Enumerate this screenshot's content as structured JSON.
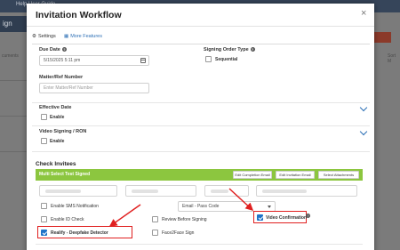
{
  "background": {
    "topbar_text": "Help User Guide",
    "app_title": "ign",
    "left_label": "cuments",
    "right_label": "Sort M"
  },
  "modal": {
    "title": "Invitation Workflow",
    "close": "×"
  },
  "tabs": [
    {
      "label": "Settings",
      "icon": "gear-icon"
    },
    {
      "label": "More Features",
      "icon": "grid-icon"
    }
  ],
  "due_date": {
    "label": "Due Date",
    "value": "5/15/2025 5:11 pm"
  },
  "signing_order": {
    "label": "Signing Order Type",
    "option": "Sequential",
    "checked": false
  },
  "matter": {
    "label": "Matter/Ref Number",
    "placeholder": "Enter Matter/Ref Number"
  },
  "effective_date": {
    "label": "Effective Date",
    "option": "Enable",
    "checked": false
  },
  "video_signing": {
    "label": "Video Signing / RON",
    "option": "Enable",
    "checked": false
  },
  "check_invitees": {
    "title": "Check Invitees",
    "bar_title": "Multi Select Test Signed",
    "buttons": [
      "Edit Completion Email",
      "Edit Invitation Email",
      "Select Attachments"
    ],
    "email_select": "Email - Pass Code",
    "options": [
      {
        "label": "Enable SMS Notification",
        "checked": false
      },
      {
        "label": "Enable ID Check",
        "checked": false
      },
      {
        "label": "Realify - Deepfake Detector",
        "checked": true
      },
      {
        "label": "Review Before Signing",
        "checked": false
      },
      {
        "label": "Face2Face Sign",
        "checked": false
      },
      {
        "label": "Video Confirmation",
        "checked": true
      }
    ]
  },
  "colors": {
    "accent": "#1f73c8",
    "green_bar": "#8cc63f",
    "highlight": "#e02020"
  }
}
